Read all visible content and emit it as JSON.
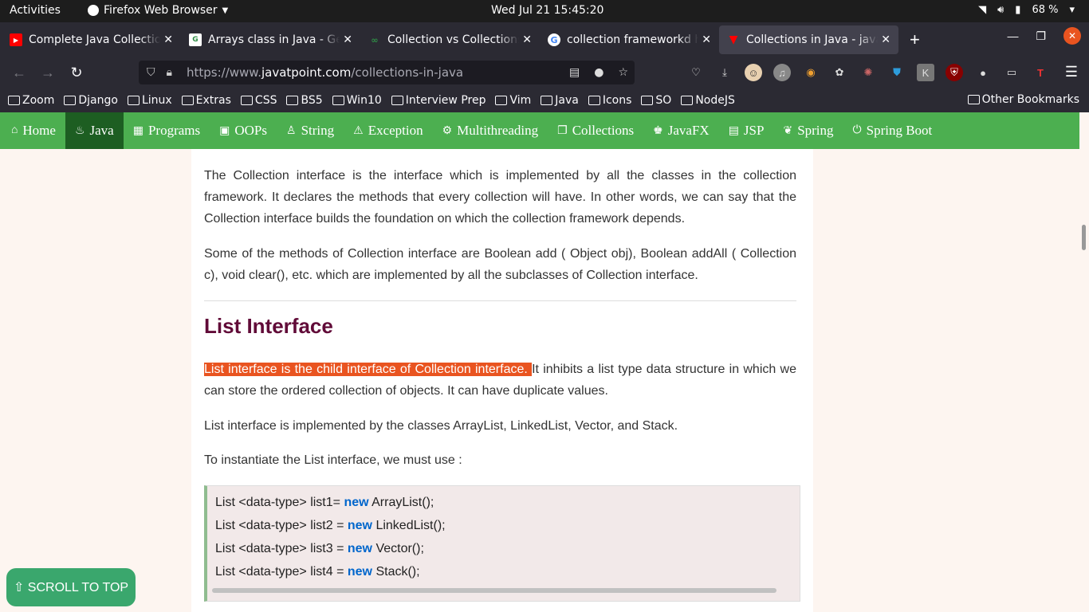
{
  "system": {
    "activities": "Activities",
    "app_name": "Firefox Web Browser",
    "clock": "Wed Jul 21  15:45:20",
    "battery": "68 %"
  },
  "tabs": [
    {
      "title": "Complete Java Collection",
      "favicon_color": "#ff0000",
      "favicon_glyph": "▶"
    },
    {
      "title": "Arrays class in Java - Gee",
      "favicon_color": "#2f8d46",
      "favicon_glyph": "G"
    },
    {
      "title": "Collection vs Collections",
      "favicon_color": "#2f8d46",
      "favicon_glyph": "G"
    },
    {
      "title": "collection frameworkd hi",
      "favicon_color": "#4285f4",
      "favicon_glyph": "G"
    },
    {
      "title": "Collections in Java - javat",
      "favicon_color": "#ff0000",
      "favicon_glyph": "▼"
    }
  ],
  "url": {
    "prefix": "https://www.",
    "domain": "javatpoint.com",
    "path": "/collections-in-java"
  },
  "bookmarks": [
    "Zoom",
    "Django",
    "Linux",
    "Extras",
    "CSS",
    "BS5",
    "Win10",
    "Interview Prep",
    "Vim",
    "Java",
    "Icons",
    "SO",
    "NodeJS"
  ],
  "other_bookmarks": "Other Bookmarks",
  "site_nav": [
    {
      "label": "Home",
      "icon": "⌂"
    },
    {
      "label": "Java",
      "icon": "♨"
    },
    {
      "label": "Programs",
      "icon": "▦"
    },
    {
      "label": "OOPs",
      "icon": "▣"
    },
    {
      "label": "String",
      "icon": "♙"
    },
    {
      "label": "Exception",
      "icon": "⚠"
    },
    {
      "label": "Multithreading",
      "icon": "⚙"
    },
    {
      "label": "Collections",
      "icon": "❐"
    },
    {
      "label": "JavaFX",
      "icon": "♚"
    },
    {
      "label": "JSP",
      "icon": "▤"
    },
    {
      "label": "Spring",
      "icon": "❦"
    },
    {
      "label": "Spring Boot",
      "icon": "⏻"
    }
  ],
  "content": {
    "p1": "The Collection interface is the interface which is implemented by all the classes in the collection framework. It declares the methods that every collection will have. In other words, we can say that the Collection interface builds the foundation on which the collection framework depends.",
    "p2": "Some of the methods of Collection interface are Boolean add ( Object obj), Boolean addAll ( Collection c), void clear(), etc. which are implemented by all the subclasses of Collection interface.",
    "h2": "List Interface",
    "p3_highlight": "List interface is the child interface of Collection interface. ",
    "p3_rest": "It inhibits a list type data structure in which we can store the ordered collection of objects. It can have duplicate values.",
    "p4": "List interface is implemented by the classes ArrayList, LinkedList, Vector, and Stack.",
    "p5": "To instantiate the List interface, we must use :",
    "code": [
      {
        "pre": "List <data-type> list1= ",
        "kw": "new",
        "post": " ArrayList();"
      },
      {
        "pre": "List <data-type> list2 = ",
        "kw": "new",
        "post": " LinkedList();"
      },
      {
        "pre": "List <data-type> list3 = ",
        "kw": "new",
        "post": " Vector();"
      },
      {
        "pre": "List <data-type> list4 = ",
        "kw": "new",
        "post": " Stack();"
      }
    ]
  },
  "scroll_to_top": "⇧ SCROLL TO TOP",
  "colors": {
    "site_nav_bg": "#4caf50",
    "site_nav_active": "#1d5e22",
    "heading": "#610b38",
    "highlight": "#e95420",
    "keyword": "#0066cc",
    "scroll_btn": "#3aa76d"
  }
}
